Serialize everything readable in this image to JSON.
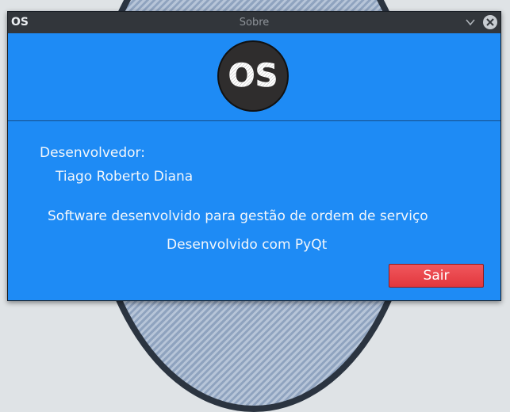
{
  "window": {
    "app_icon_text": "OS",
    "title": "Sobre"
  },
  "logo": {
    "text": "OS"
  },
  "content": {
    "developer_label": "Desenvolvedor:",
    "developer_name": "Tiago Roberto Diana",
    "description": "Software desenvolvido para gestão de ordem de serviço",
    "built_with": "Desenvolvido com PyQt"
  },
  "actions": {
    "quit_label": "Sair"
  },
  "colors": {
    "window_background": "#1e8bf5",
    "titlebar_background": "#32363b",
    "quit_button": "#e8434a",
    "logo_background": "#2f2d2d"
  },
  "icons": {
    "app": "os-logo-icon",
    "minimize": "chevron-down-icon",
    "close": "close-icon"
  }
}
